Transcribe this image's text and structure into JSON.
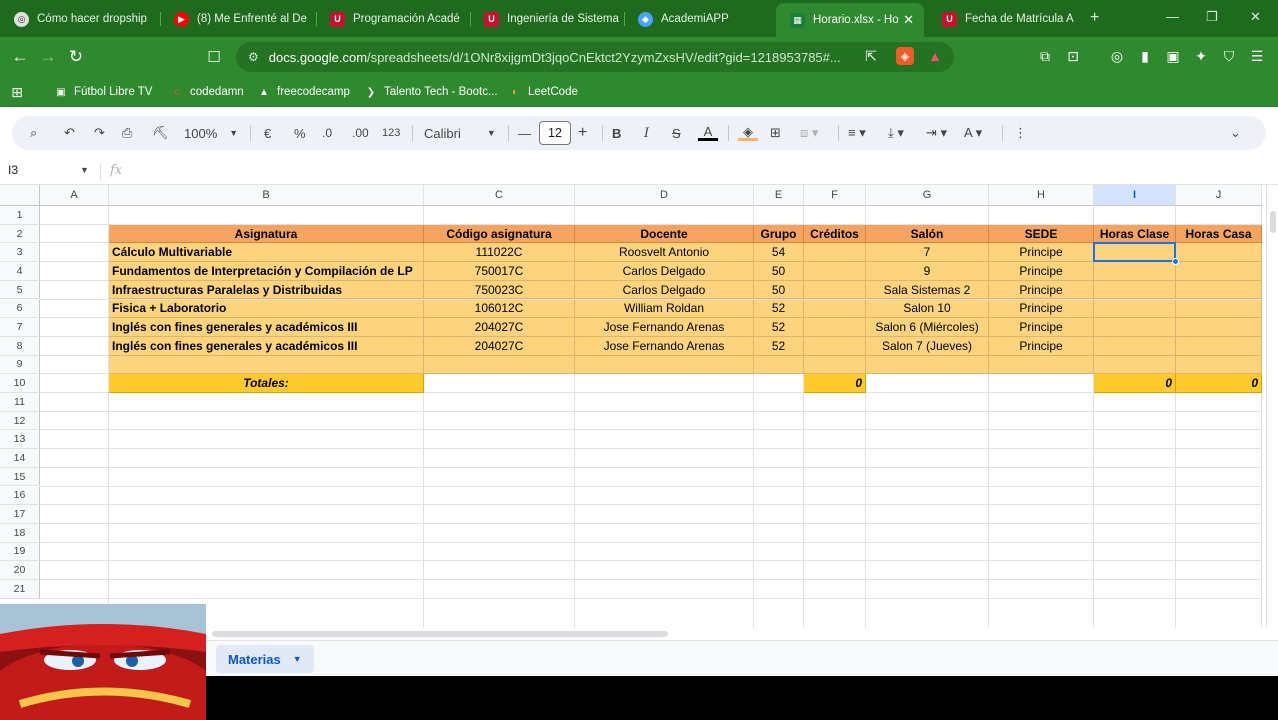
{
  "browser": {
    "tabs": [
      {
        "title": "Cómo hacer dropship",
        "icon": "globe-icon",
        "color": "#e0e0e0"
      },
      {
        "title": "(8) Me Enfrenté al De",
        "icon": "youtube-icon",
        "color": "#ff0000"
      },
      {
        "title": "Programación Acadé",
        "icon": "univalle-icon",
        "color": "#c8102e"
      },
      {
        "title": "Ingeniería de Sistema",
        "icon": "univalle-icon",
        "color": "#c8102e"
      },
      {
        "title": "AcademiAPP",
        "icon": "academiapp-icon",
        "color": "#4aa3ff"
      },
      {
        "title": "Horario.xlsx - Ho",
        "icon": "sheets-icon",
        "color": "#188038",
        "active": true
      },
      {
        "title": "Fecha de Matrícula A",
        "icon": "univalle-icon",
        "color": "#c8102e"
      }
    ],
    "url_host": "docs.google.com",
    "url_path": "/spreadsheets/d/1ONr8xijgmDt3jqoCnEktct2YzymZxsHV/edit?gid=1218953785#...",
    "bookmarks": [
      {
        "label": "Fútbol Libre TV",
        "icon": "tv-icon"
      },
      {
        "label": "codedamn",
        "icon": "codedamn-icon"
      },
      {
        "label": "freecodecamp",
        "icon": "freecodecamp-icon"
      },
      {
        "label": "Talento Tech - Bootc...",
        "icon": "arrow-icon"
      },
      {
        "label": "LeetCode",
        "icon": "leetcode-icon"
      }
    ]
  },
  "toolbar": {
    "zoom": "100%",
    "currency": "€",
    "percent": "%",
    "dec_decrease": ".0",
    "dec_increase": ".00",
    "format_number": "123",
    "font": "Calibri",
    "font_size": "12"
  },
  "formula_bar": {
    "name_box": "I3",
    "fx": "fx"
  },
  "sheet": {
    "columns": [
      "A",
      "B",
      "C",
      "D",
      "E",
      "F",
      "G",
      "H",
      "I",
      "J"
    ],
    "rows": [
      "1",
      "2",
      "3",
      "4",
      "5",
      "6",
      "7",
      "8",
      "9",
      "10",
      "11",
      "12",
      "13",
      "14",
      "15",
      "16",
      "17",
      "18",
      "19",
      "20",
      "21"
    ],
    "header": [
      "Asignatura",
      "Código asignatura",
      "Docente",
      "Grupo",
      "Créditos",
      "Salón",
      "SEDE",
      "Horas Clase",
      "Horas Casa"
    ],
    "data": [
      [
        "Cálculo Multivariable",
        "111022C",
        "Roosvelt Antonio",
        "54",
        "",
        "7",
        "Principe",
        "",
        ""
      ],
      [
        "Fundamentos de Interpretación y Compilación de LP",
        "750017C",
        "Carlos Delgado",
        "50",
        "",
        "9",
        "Principe",
        "",
        ""
      ],
      [
        "Infraestructuras Paralelas y Distribuidas",
        "750023C",
        "Carlos Delgado",
        "50",
        "",
        "Sala Sistemas 2",
        "Principe",
        "",
        ""
      ],
      [
        "Fisica + Laboratorio",
        "106012C",
        "William Roldan",
        "52",
        "",
        "Salon 10",
        "Principe",
        "",
        ""
      ],
      [
        "Inglés con fines generales y académicos III",
        "204027C",
        "Jose Fernando Arenas",
        "52",
        "",
        "Salon 6 (Miércoles)",
        "Principe",
        "",
        ""
      ],
      [
        "Inglés con fines generales y académicos III",
        "204027C",
        "Jose Fernando Arenas",
        "52",
        "",
        "Salon 7 (Jueves)",
        "Principe",
        "",
        ""
      ],
      [
        "",
        "",
        "",
        "",
        "",
        "",
        "",
        "",
        ""
      ]
    ],
    "totals_label": "Totales:",
    "total_creditos": "0",
    "total_horas_clase": "0",
    "total_horas_casa": "0",
    "selected_cell": "I3",
    "sheet_tab": "Materias"
  },
  "colors": {
    "header_fill": "#f4a460",
    "body_fill": "#fdd47e",
    "total_fill": "#ffca2c",
    "browser_green": "#2f8a2f"
  }
}
